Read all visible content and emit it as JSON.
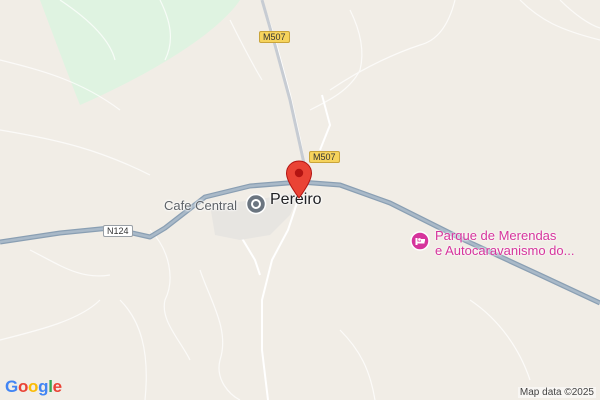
{
  "map": {
    "roads": [
      {
        "ref": "M507"
      },
      {
        "ref": "M507"
      },
      {
        "ref": "N124"
      }
    ],
    "places": [
      {
        "name": "Pereiro"
      },
      {
        "name": "Cafe Central"
      },
      {
        "name": "Parque de Merendas\ne Autocaravanismo do..."
      }
    ],
    "attribution": "Map data ©2025",
    "logo": {
      "text": "Google",
      "colors": [
        "#4285F4",
        "#EA4335",
        "#FBBC05",
        "#4285F4",
        "#34A853",
        "#EA4335"
      ]
    },
    "colors": {
      "land": "#f1ede6",
      "park": "#dff3e1",
      "highway": "#8a9fb3",
      "marker": "#ea4335",
      "poi": "#d6349c"
    }
  }
}
